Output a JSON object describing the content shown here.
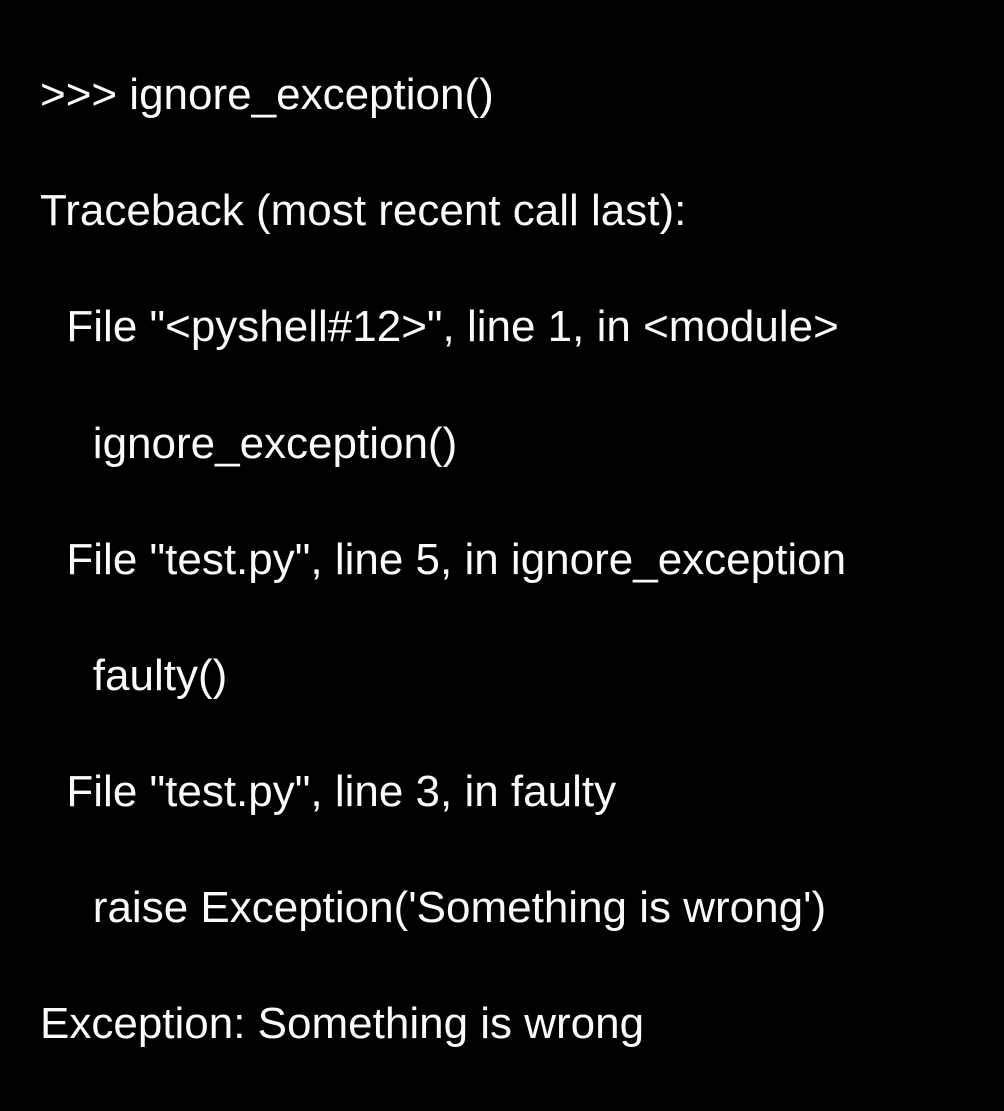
{
  "traceback": {
    "l0": ">>> ignore_exception()",
    "l1": "Traceback (most recent call last):",
    "l2": "File \"<pyshell#12>\", line 1, in <module>",
    "l3": "ignore_exception()",
    "l4": "File \"test.py\", line 5, in ignore_exception",
    "l5": "faulty()",
    "l6": "File \"test.py\", line 3, in faulty",
    "l7": "raise Exception('Something is wrong')",
    "l8": "Exception: Something is wrong"
  }
}
